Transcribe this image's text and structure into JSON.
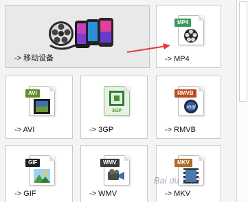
{
  "tiles": {
    "mobile": {
      "label": "-> 移动设备"
    },
    "mp4": {
      "label": "-> MP4",
      "badge": "MP4"
    },
    "avi": {
      "label": "-> AVI",
      "badge": "AVI"
    },
    "3gp": {
      "label": "-> 3GP",
      "badge": "3GP"
    },
    "rmvb": {
      "label": "-> RMVB",
      "badge": "RMVB"
    },
    "gif": {
      "label": "-> GIF",
      "badge": "GIF"
    },
    "wmv": {
      "label": "-> WMV",
      "badge": "WMV"
    },
    "mkv": {
      "label": "-> MKV",
      "badge": "MKV"
    }
  },
  "watermark": "Bai du 经验",
  "colors": {
    "mp4_badge": "#3a9a5a",
    "avi_badge": "#5c8f2a",
    "3gp_text": "#4a8f3a",
    "rmvb_badge": "#c14a1f",
    "gif_badge": "#1f1f1f",
    "wmv_badge": "#3b3b3b",
    "mkv_badge": "#b06a2a",
    "arrow": "#e23a3a"
  }
}
